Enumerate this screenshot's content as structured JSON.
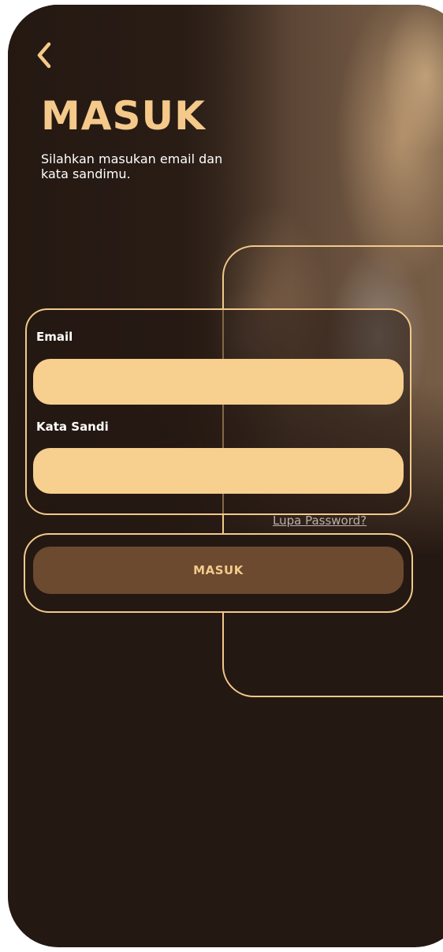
{
  "header": {
    "back_icon": "chevron-left-icon",
    "title": "MASUK",
    "subtitle": "Silahkan masukan email dan kata sandimu."
  },
  "form": {
    "email_label": "Email",
    "email_value": "",
    "password_label": "Kata Sandi",
    "password_value": "",
    "forgot_link": "Lupa Password?"
  },
  "actions": {
    "submit_label": "MASUK"
  },
  "colors": {
    "background": "#241812",
    "accent": "#f5c98a",
    "input_fill": "#f7cf8e",
    "button_fill": "#6b4a2f"
  }
}
